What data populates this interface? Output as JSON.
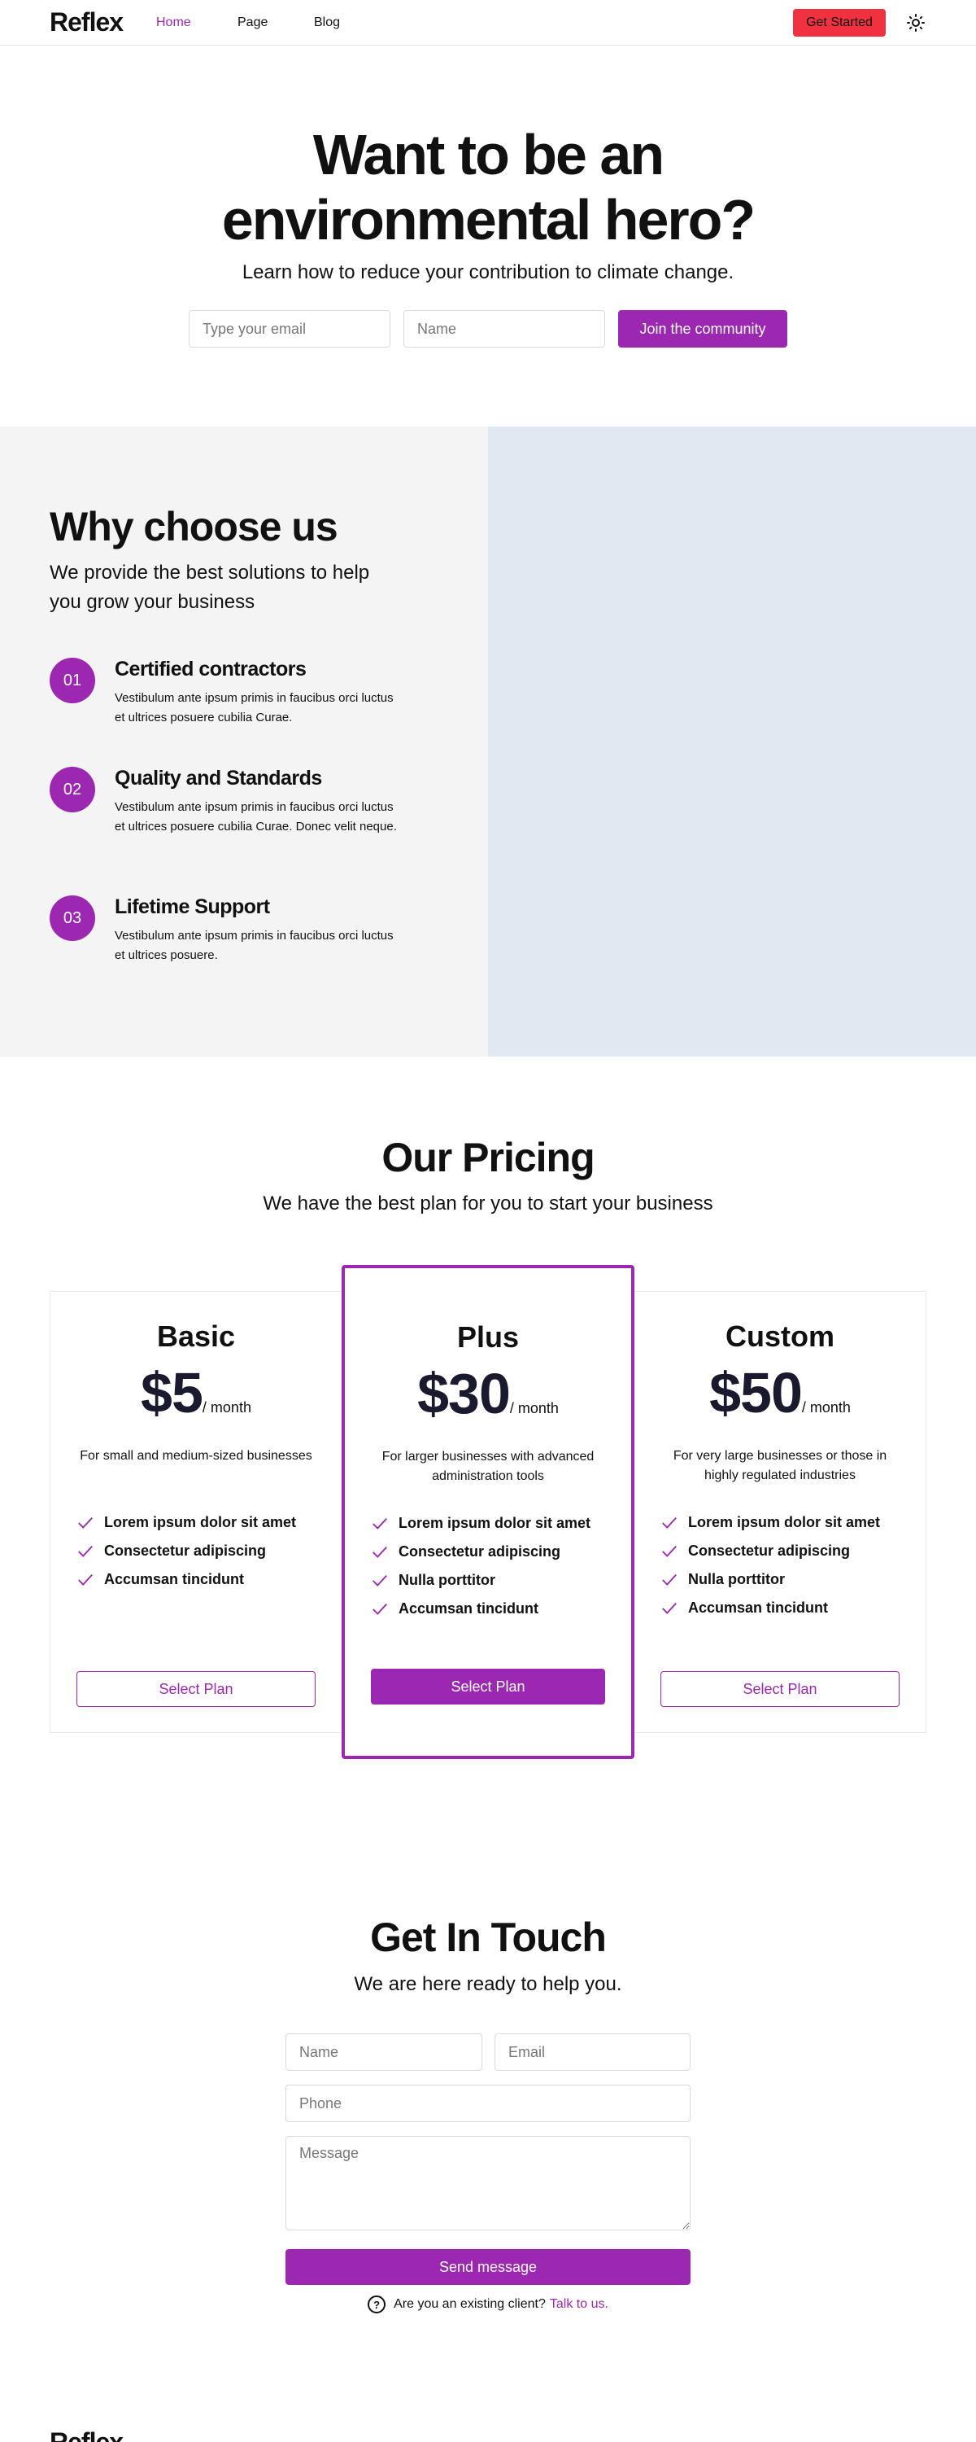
{
  "navbar": {
    "logo": "Reflex",
    "links": [
      {
        "label": "Home",
        "active": true
      },
      {
        "label": "Page",
        "active": false
      },
      {
        "label": "Blog",
        "active": false
      }
    ],
    "cta_label": "Get Started",
    "theme_icon": "sun-icon"
  },
  "hero": {
    "title": "Want to be an environmental hero?",
    "subtitle": "Learn how to reduce your contribution to climate change.",
    "email_placeholder": "Type your email",
    "name_placeholder": "Name",
    "join_label": "Join the community"
  },
  "why": {
    "title": "Why choose us",
    "subtitle": "We provide the best solutions to help you grow your business",
    "features": [
      {
        "number": "01",
        "title": "Certified contractors",
        "description": "Vestibulum ante ipsum primis in faucibus orci luctus et ultrices posuere cubilia Curae."
      },
      {
        "number": "02",
        "title": "Quality and Standards",
        "description": "Vestibulum ante ipsum primis in faucibus orci luctus et ultrices posuere cubilia Curae. Donec velit neque."
      },
      {
        "number": "03",
        "title": "Lifetime Support",
        "description": "Vestibulum ante ipsum primis in faucibus orci luctus et ultrices posuere."
      }
    ]
  },
  "pricing": {
    "title": "Our Pricing",
    "subtitle": "We have the best plan for you to start your business",
    "plans": [
      {
        "name": "Basic",
        "price": "$5",
        "period": "/ month",
        "description": "For small and medium-sized businesses",
        "features": [
          "Lorem ipsum dolor sit amet",
          "Consectetur adipiscing",
          "Accumsan tincidunt"
        ],
        "button": "Select Plan"
      },
      {
        "name": "Plus",
        "price": "$30",
        "period": "/ month",
        "description": "For larger businesses with advanced administration tools",
        "features": [
          "Lorem ipsum dolor sit amet",
          "Consectetur adipiscing",
          "Nulla porttitor",
          "Accumsan tincidunt"
        ],
        "button": "Select Plan"
      },
      {
        "name": "Custom",
        "price": "$50",
        "period": "/ month",
        "description": "For very large businesses or those in highly regulated industries",
        "features": [
          "Lorem ipsum dolor sit amet",
          "Consectetur adipiscing",
          "Nulla porttitor",
          "Accumsan tincidunt"
        ],
        "button": "Select Plan"
      }
    ]
  },
  "contact": {
    "title": "Get In Touch",
    "subtitle": "We are here ready to help you.",
    "name_placeholder": "Name",
    "email_placeholder": "Email",
    "phone_placeholder": "Phone",
    "message_placeholder": "Message",
    "send_label": "Send message",
    "existing_text": "Are you an existing client?",
    "talk_link": "Talk to us."
  },
  "footer": {
    "logo": "Reflex"
  },
  "colors": {
    "accent": "#9c27b0",
    "cta": "#f0313f",
    "panel_gray": "#f4f4f4",
    "panel_blue": "#e2e8f2"
  }
}
